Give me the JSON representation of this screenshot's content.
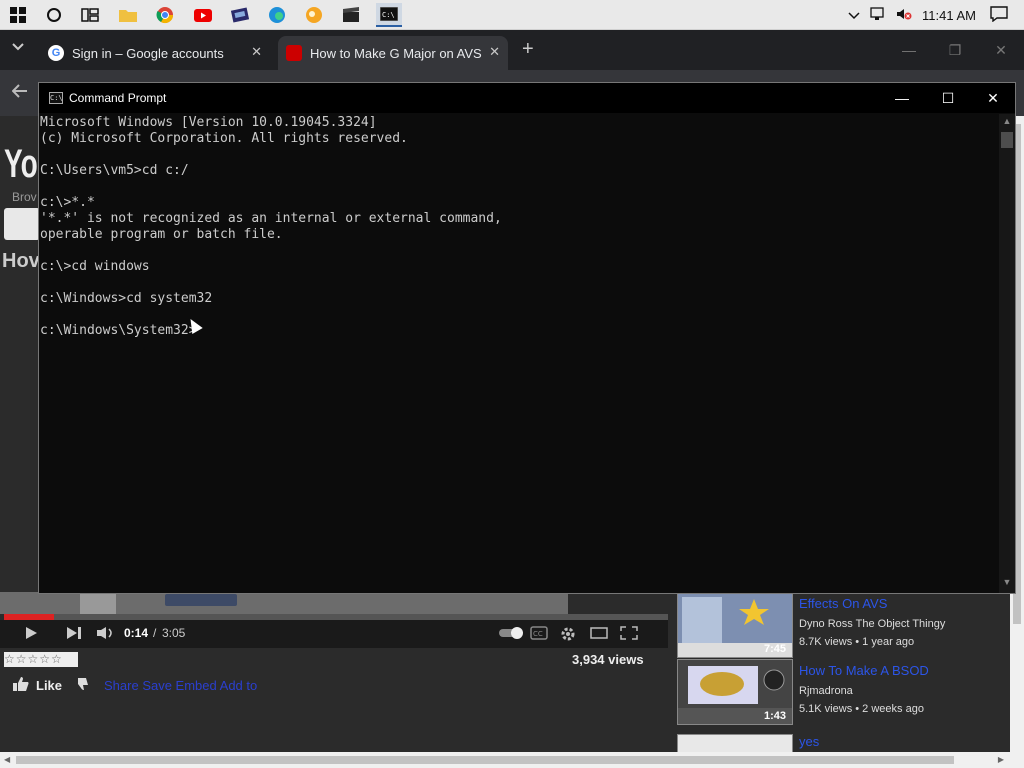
{
  "taskbar": {
    "icons": [
      "windows-start",
      "cortana",
      "task-view",
      "file-explorer",
      "chrome",
      "youtube",
      "video-editor",
      "edge",
      "pinned-app",
      "film-app",
      "command-prompt"
    ],
    "clock": "11:41 AM"
  },
  "browser": {
    "tabs": [
      {
        "title": "Sign in – Google accounts",
        "favicon_color": "#4285f4"
      },
      {
        "title": "How to Make G Major on AVS",
        "favicon_color": "#cc0000"
      }
    ],
    "new_tab": "+"
  },
  "youtube": {
    "logo": "Yo",
    "browse": "Brov",
    "title_fragment": "Hov",
    "player": {
      "time_current": "0:14",
      "time_total": "3:05",
      "progress_fraction": 0.075
    },
    "views": "3,934 views",
    "like_label": "Like",
    "action_links": "Share  Save  Embed  Add to",
    "related": [
      {
        "title": "Effects On AVS",
        "channel": "Dyno Ross The Object Thingy",
        "views": "8.7K views",
        "age": "1 year ago",
        "duration": "7:45"
      },
      {
        "title": "How To Make A BSOD",
        "channel": "Rjmadrona",
        "views": "5.1K views",
        "age": "2 weeks ago",
        "duration": "1:43"
      },
      {
        "title": "yes",
        "channel": "",
        "views": "",
        "age": "",
        "duration": ""
      }
    ]
  },
  "cmd": {
    "title": "Command Prompt",
    "lines": [
      "Microsoft Windows [Version 10.0.19045.3324]",
      "(c) Microsoft Corporation. All rights reserved.",
      "",
      "C:\\Users\\vm5>cd c:/",
      "",
      "c:\\>*.*",
      "'*.*' is not recognized as an internal or external command,",
      "operable program or batch file.",
      "",
      "c:\\>cd windows",
      "",
      "c:\\Windows>cd system32",
      "",
      "c:\\Windows\\System32>"
    ]
  }
}
